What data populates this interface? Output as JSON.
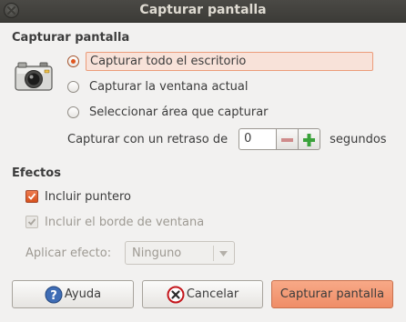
{
  "window": {
    "title": "Capturar pantalla"
  },
  "capture": {
    "section_title": "Capturar pantalla",
    "options": [
      {
        "label": "Capturar todo el escritorio",
        "selected": true
      },
      {
        "label": "Capturar la ventana actual",
        "selected": false
      },
      {
        "label": "Seleccionar área que capturar",
        "selected": false
      }
    ],
    "delay": {
      "label": "Capturar con un retraso de",
      "value": "0",
      "unit": "segundos"
    }
  },
  "effects": {
    "section_title": "Efectos",
    "include_pointer": {
      "label": "Incluir puntero",
      "checked": true
    },
    "include_border": {
      "label": "Incluir el borde de ventana",
      "checked": true,
      "disabled": true
    },
    "apply_effect": {
      "label": "Aplicar efecto:",
      "value": "Ninguno",
      "disabled": true
    }
  },
  "buttons": {
    "help": "Ayuda",
    "cancel": "Cancelar",
    "capture": "Capturar pantalla"
  },
  "colors": {
    "accent": "#e0561f",
    "focus_bg": "#f8e2d9",
    "focus_border": "#ec9c7a",
    "titlebar": "#3c3b37"
  }
}
